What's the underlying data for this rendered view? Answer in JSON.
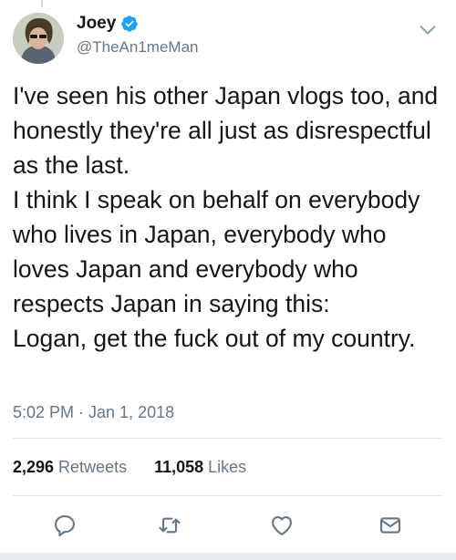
{
  "tweet": {
    "author": {
      "display_name": "Joey",
      "handle": "@TheAn1meMan",
      "verified": true
    },
    "text_lines": [
      "I've seen his other Japan vlogs too, and",
      "honestly they're all just as disrespectful",
      "as the last.",
      "I think I speak on behalf on everybody",
      "who lives in Japan, everybody who",
      "loves Japan and everybody who",
      "respects Japan in saying this:",
      "Logan, get the fuck out of my country."
    ],
    "timestamp": "5:02 PM · Jan 1, 2018",
    "stats": {
      "retweets_count": "2,296",
      "retweets_label": "Retweets",
      "likes_count": "11,058",
      "likes_label": "Likes"
    },
    "actions": [
      {
        "name": "reply",
        "icon": "reply-icon"
      },
      {
        "name": "retweet",
        "icon": "retweet-icon"
      },
      {
        "name": "like",
        "icon": "heart-icon"
      },
      {
        "name": "share",
        "icon": "envelope-icon"
      }
    ]
  },
  "colors": {
    "verified_blue": "#1da1f2",
    "secondary_text": "#657786",
    "icon_gray": "#657786",
    "divider": "#e1e8ed"
  }
}
